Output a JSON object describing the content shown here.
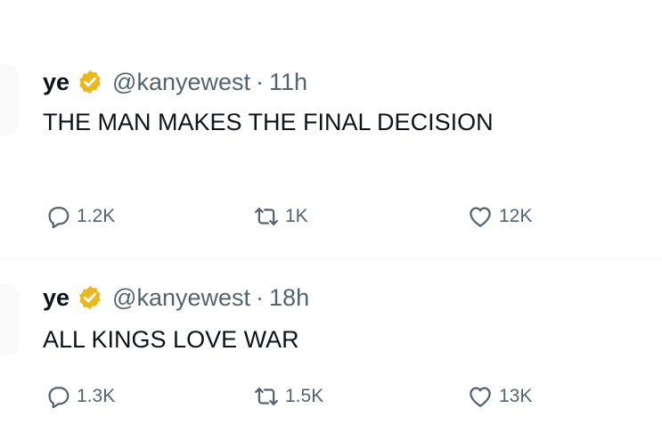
{
  "tweets": [
    {
      "name": "ye",
      "handle": "@kanyewest",
      "separator": "·",
      "time": "11h",
      "text": "THE MAN MAKES THE FINAL DECISION",
      "replies": "1.2K",
      "retweets": "1K",
      "likes": "12K"
    },
    {
      "name": "ye",
      "handle": "@kanyewest",
      "separator": "·",
      "time": "18h",
      "text": "ALL KINGS LOVE WAR",
      "replies": "1.3K",
      "retweets": "1.5K",
      "likes": "13K"
    }
  ],
  "colors": {
    "text": "#0f1419",
    "secondary": "#536471",
    "badge": "#e8b722",
    "divider": "#eff3f4"
  },
  "icons": [
    "verified-badge-icon",
    "reply-icon",
    "retweet-icon",
    "like-icon"
  ]
}
